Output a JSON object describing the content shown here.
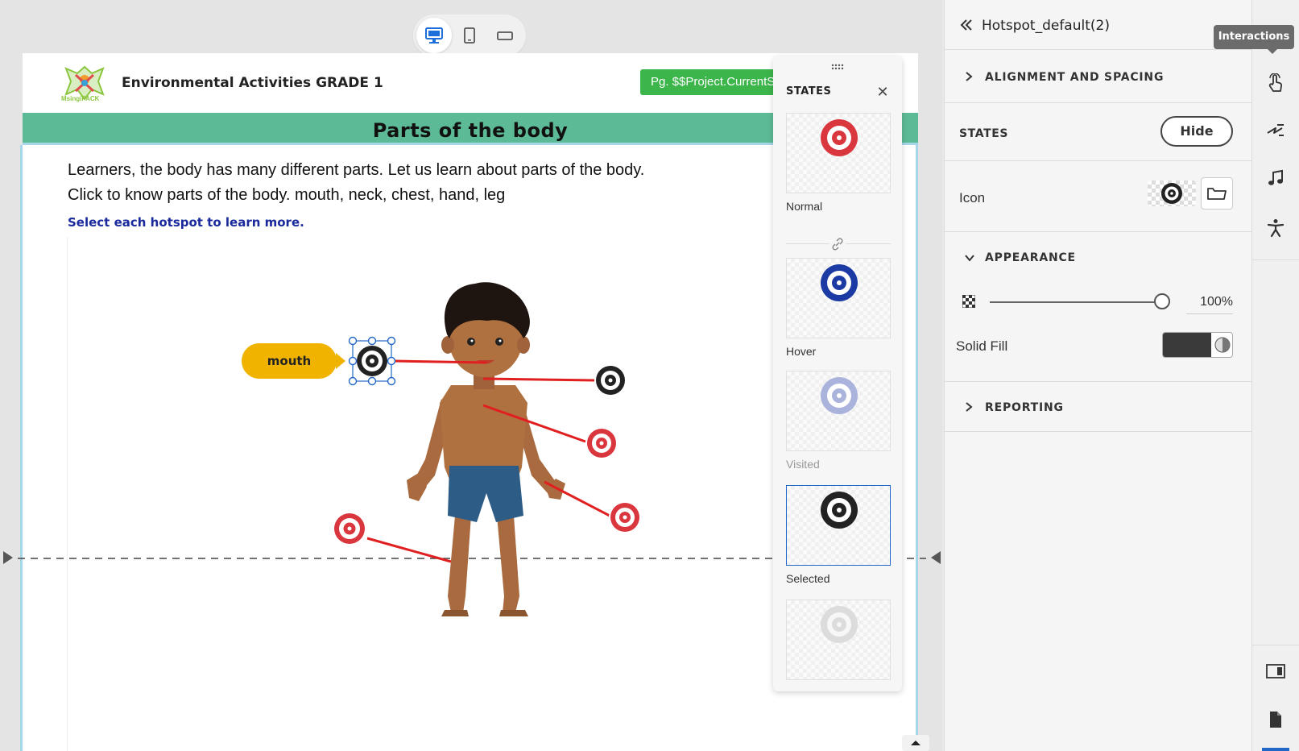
{
  "canvas": {
    "device_modes": [
      {
        "name": "desktop",
        "active": true
      },
      {
        "name": "tablet",
        "active": false
      },
      {
        "name": "mobile-landscape",
        "active": false
      }
    ]
  },
  "slide": {
    "course_title": "Environmental Activities GRADE 1",
    "logo_text": "MsingiPACK",
    "page_badge": "Pg. $$Project.CurrentSlide",
    "title": "Parts of the body",
    "intro_line_1": "Learners, the body has many different parts. Let us learn about parts of the body.",
    "intro_line_2": "Click to know parts of the body. mouth, neck, chest, hand, leg",
    "instruction": "Select each hotspot to learn more.",
    "hotspot_label": "mouth",
    "colors": {
      "title_band": "#5dba96",
      "instruction": "#1a2a9c",
      "label_bg": "#f0b400",
      "hotspot_red": "#d9363e",
      "hotspot_dark": "#222222",
      "badge": "#3cb54a"
    }
  },
  "states_panel": {
    "title": "STATES",
    "close_icon": "close-icon",
    "states": [
      {
        "label": "Normal",
        "color": "#d9363e"
      },
      {
        "label": "Hover",
        "color": "#1b3aa3"
      },
      {
        "label": "Visited",
        "color": "#a9b3dc"
      },
      {
        "label": "Selected",
        "color": "#222222"
      },
      {
        "label": "",
        "color": "#dcdcdc"
      }
    ]
  },
  "properties": {
    "object_name": "Hotspot_default(2)",
    "sections": {
      "alignment": "ALIGNMENT AND SPACING",
      "states": "STATES",
      "appearance": "APPEARANCE",
      "reporting": "REPORTING"
    },
    "hide_button": "Hide",
    "icon_label": "Icon",
    "opacity_value": "100%",
    "opacity_fraction": 1.0,
    "solid_fill_label": "Solid Fill",
    "solid_fill_color": "#3a3a3a"
  },
  "rail": {
    "tooltip": "Interactions",
    "icons": [
      "interactions-icon",
      "effects-icon",
      "audio-icon",
      "accessibility-icon",
      "slide-properties-icon",
      "document-icon"
    ]
  }
}
